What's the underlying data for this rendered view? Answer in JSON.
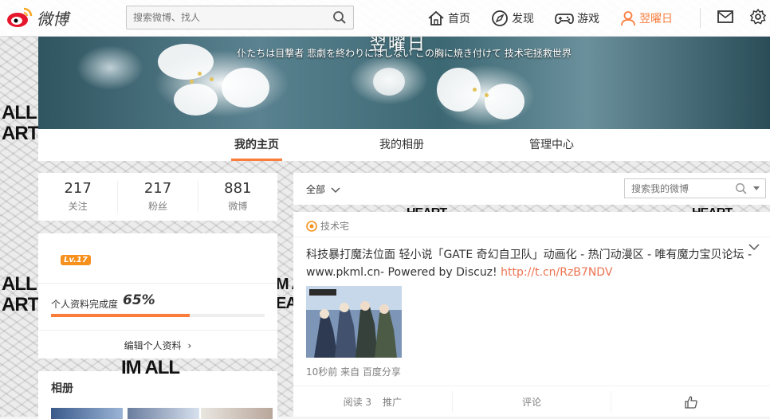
{
  "topbar": {
    "logo_text": "微博",
    "search_placeholder": "搜索微博、找人",
    "nav": [
      {
        "label": "首页",
        "icon": "home-icon"
      },
      {
        "label": "发现",
        "icon": "compass-icon"
      },
      {
        "label": "游戏",
        "icon": "gamepad-icon"
      },
      {
        "label": "翌曜日",
        "icon": "user-icon"
      }
    ],
    "accent_color": "#fa7d3c"
  },
  "cover": {
    "name": "翌曜日",
    "motto": "仆たちは目撃者 悲劇を終わりにはしない この胸に焼き付けて 技术宅拯救世界"
  },
  "tabs": [
    "我的主页",
    "我的相册",
    "管理中心"
  ],
  "stats": [
    {
      "num": "217",
      "label": "关注"
    },
    {
      "num": "217",
      "label": "粉丝"
    },
    {
      "num": "881",
      "label": "微博"
    }
  ],
  "level": {
    "badge": "Lv.17",
    "profile_label": "个人资料完成度",
    "profile_pct": "65%",
    "profile_fraction": 0.65,
    "edit_label": "编辑个人资料"
  },
  "album": {
    "title": "相册"
  },
  "feed": {
    "filter_label": "全部",
    "search_placeholder": "搜索我的微博"
  },
  "post": {
    "source": "技术宅",
    "text": "科技暴打魔法位面 轻小说「GATE 奇幻自卫队」动画化 - 热门动漫区 - 唯有魔力宝贝论坛 -www.pkml.cn- Powered by Discuz!",
    "link": "http://t.cn/RzB7NDV",
    "meta": "10秒前 来自 百度分享",
    "actions": {
      "read": "阅读 3",
      "promote": "推广",
      "comment": "评论"
    }
  },
  "background_words": [
    "ALL",
    "ART",
    "ALL",
    "ART",
    "IM ALL",
    "HEART",
    "HEART",
    "M AL",
    "EA"
  ]
}
